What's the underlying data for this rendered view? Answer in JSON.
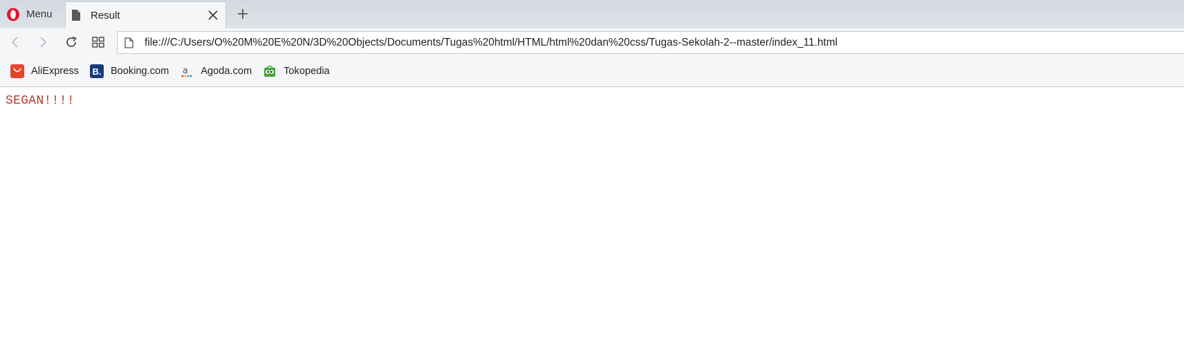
{
  "browser": {
    "menu_label": "Menu",
    "tab": {
      "title": "Result"
    },
    "address_url": "file:///C:/Users/O%20M%20E%20N/3D%20Objects/Documents/Tugas%20html/HTML/html%20dan%20css/Tugas-Sekolah-2--master/index_11.html",
    "bookmarks": [
      {
        "label": "AliExpress",
        "icon": "aliexpress-icon",
        "color": "#e8432b"
      },
      {
        "label": "Booking.com",
        "icon": "booking-icon",
        "color": "#1b3a7a"
      },
      {
        "label": "Agoda.com",
        "icon": "agoda-icon",
        "color": "#555555"
      },
      {
        "label": "Tokopedia",
        "icon": "tokopedia-icon",
        "color": "#3fa535"
      }
    ]
  },
  "page": {
    "text": "SEGAN!!!!",
    "text_color": "#b03a2e"
  },
  "colors": {
    "opera_red": "#e0162b",
    "tabstrip": "#d3d8e0",
    "toolbar": "#f5f6f8"
  }
}
